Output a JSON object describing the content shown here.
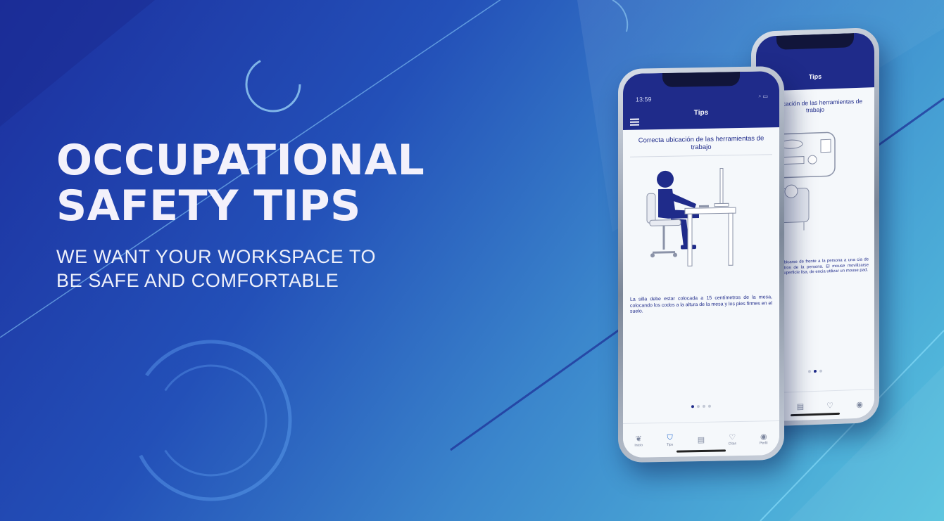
{
  "hero": {
    "title_line1": "OCCUPATIONAL",
    "title_line2": "SAFETY TIPS",
    "subtitle_line1": "WE WANT YOUR WORKSPACE TO",
    "subtitle_line2": "BE SAFE AND COMFORTABLE"
  },
  "front_phone": {
    "status_time": "13:59",
    "header_title": "Tips",
    "tip_title": "Correcta ubicación de las herramientas de trabajo",
    "tip_text": "La silla debe estar colocada a 15 centímetros de la mesa, colocando los codos a la altura de la mesa y los pies firmes en el suelo.",
    "carousel_active_index": 0,
    "carousel_count": 4,
    "tabs": [
      {
        "label": "Inicio",
        "icon": "leaf-icon"
      },
      {
        "label": "Tips",
        "icon": "shield-check-icon",
        "active": true
      },
      {
        "label": "",
        "icon": "document-icon"
      },
      {
        "label": "Citas",
        "icon": "heart-pulse-icon"
      },
      {
        "label": "Perfil",
        "icon": "user-icon"
      }
    ]
  },
  "back_phone": {
    "header_title": "Tips",
    "tip_title": "ta ubicación de las herramientas de trabajo",
    "tip_text": "ado debe ubicarse de frente a la persona a una cia de 15 centímetros de la persona. El mouse movilizarse sobre una superficie lisa, de encia utilizar un mouse pad.",
    "carousel_active_index": 1,
    "carousel_count": 3
  },
  "colors": {
    "brand_navy": "#1f2b8a",
    "accent_blue": "#2b6fd1",
    "bg_start": "#1c2f9e",
    "bg_end": "#56c3de"
  }
}
